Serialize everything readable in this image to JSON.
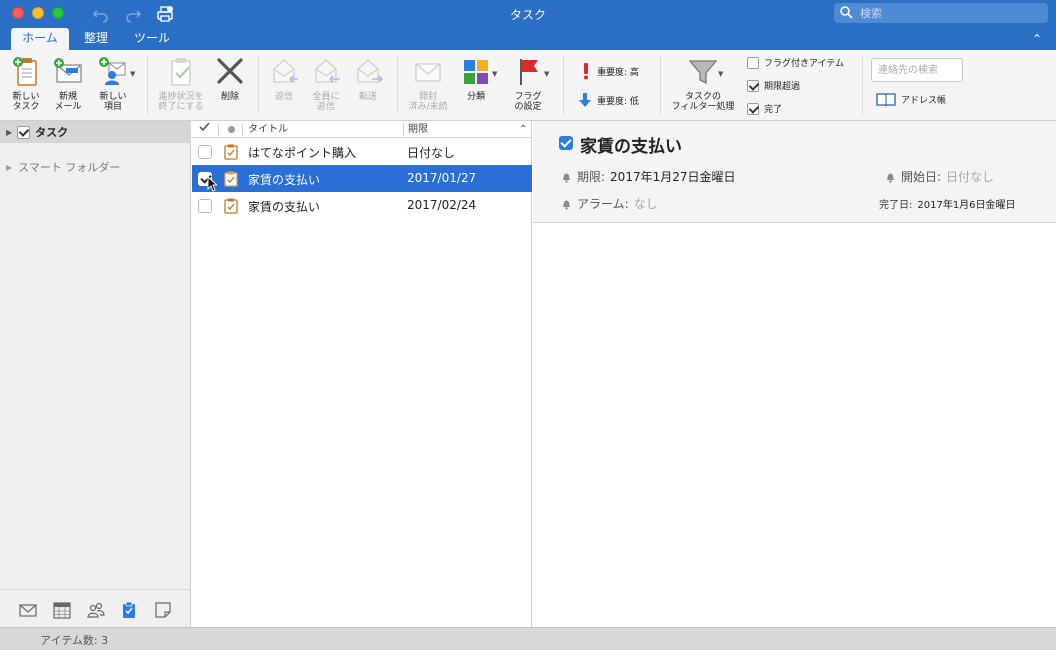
{
  "window": {
    "title": "タスク",
    "search_placeholder": "検索"
  },
  "tabs": [
    {
      "label": "ホーム",
      "active": true
    },
    {
      "label": "整理",
      "active": false
    },
    {
      "label": "ツール",
      "active": false
    }
  ],
  "ribbon": {
    "new_task": [
      "新しい",
      "タスク"
    ],
    "new_mail": [
      "新規",
      "メール"
    ],
    "new_item": [
      "新しい",
      "項目"
    ],
    "mark_complete": [
      "進捗状況を",
      "終了にする"
    ],
    "delete": "削除",
    "reply": "返信",
    "reply_all": [
      "全員に",
      "返信"
    ],
    "forward": "転送",
    "open_unread": [
      "開封",
      "済み/未読"
    ],
    "categorize": "分類",
    "follow_up": [
      "フラグ",
      "の設定"
    ],
    "high_importance": "重要度: 高",
    "low_importance": "重要度: 低",
    "filter": [
      "タスクの",
      "フィルター処理"
    ],
    "filter_options": [
      {
        "label": "フラグ付きアイテム",
        "checked": false
      },
      {
        "label": "期限超過",
        "checked": true
      },
      {
        "label": "完了",
        "checked": true
      }
    ],
    "contact_search_placeholder": "連絡先の検索",
    "address_book": "アドレス帳"
  },
  "sidebar": {
    "folder": "タスク",
    "smart_folders": "スマート フォルダー",
    "nav_icons": [
      "mail-icon",
      "calendar-icon",
      "people-icon",
      "tasks-icon",
      "notes-icon"
    ]
  },
  "list": {
    "columns": {
      "title": "タイトル",
      "due": "期限"
    },
    "rows": [
      {
        "title": "はてなポイント購入",
        "due": "日付なし",
        "checked": false,
        "selected": false
      },
      {
        "title": "家賃の支払い",
        "due": "2017/01/27",
        "checked": true,
        "selected": true
      },
      {
        "title": "家賃の支払い",
        "due": "2017/02/24",
        "checked": false,
        "selected": false
      }
    ]
  },
  "detail": {
    "title": "家賃の支払い",
    "due_label": "期限:",
    "due_value": "2017年1月27日金曜日",
    "start_label": "開始日:",
    "start_value": "日付なし",
    "alarm_label": "アラーム:",
    "alarm_value": "なし",
    "completed_label": "完了日:",
    "completed_value": "2017年1月6日金曜日"
  },
  "status": {
    "item_count": "アイテム数: 3"
  },
  "colors": {
    "accent": "#2a6fc4",
    "selection": "#2a6fd6"
  }
}
